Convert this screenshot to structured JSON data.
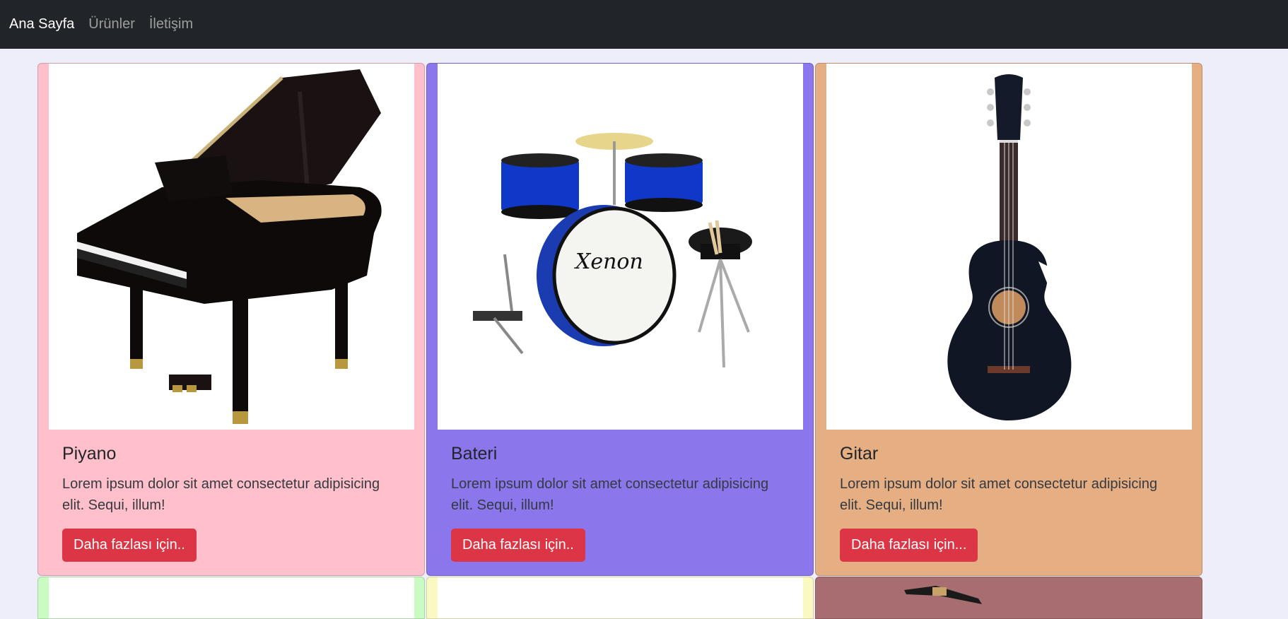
{
  "navbar": {
    "items": [
      {
        "label": "Ana Sayfa"
      },
      {
        "label": "Ürünler"
      },
      {
        "label": "İletişim"
      }
    ]
  },
  "cards": [
    {
      "title": "Piyano",
      "text": "Lorem ipsum dolor sit amet consectetur adipisicing elit. Sequi, illum!",
      "button": "Daha fazlası için..",
      "bg": "#ffc0cb",
      "image": "grand-piano"
    },
    {
      "title": "Bateri",
      "text": "Lorem ipsum dolor sit amet consectetur adipisicing elit. Sequi, illum!",
      "button": "Daha fazlası için..",
      "bg": "#8b77eb",
      "image": "drum-kit"
    },
    {
      "title": "Gitar",
      "text": "Lorem ipsum dolor sit amet consectetur adipisicing elit. Sequi, illum!",
      "button": "Daha fazlası için...",
      "bg": "#e6ae83",
      "image": "acoustic-guitar"
    }
  ],
  "second_row": [
    {
      "bg": "#c9fbc3"
    },
    {
      "bg": "#fbf9c2"
    },
    {
      "bg": "#a86d70",
      "image": "saxophone"
    }
  ],
  "colors": {
    "navbar_bg": "#212529",
    "page_bg": "#eeeefb",
    "button_bg": "#dc3545"
  }
}
